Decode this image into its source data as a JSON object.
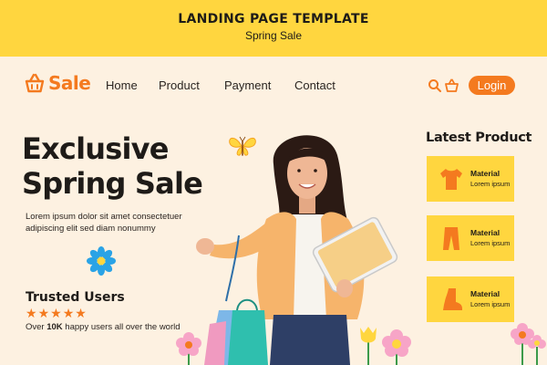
{
  "banner": {
    "title": "LANDING PAGE TEMPLATE",
    "subtitle": "Spring Sale"
  },
  "nav": {
    "brand": "Sale",
    "links": [
      "Home",
      "Product",
      "Payment",
      "Contact"
    ],
    "login_label": "Login",
    "icons": [
      "search-icon",
      "basket-icon"
    ]
  },
  "hero": {
    "headline_line1": "Exclusive",
    "headline_line2": "Spring Sale",
    "description": "Lorem ipsum dolor sit amet consectetuer adipiscing elit sed diam nonummy"
  },
  "trusted": {
    "title": "Trusted Users",
    "rating": 5,
    "desc_prefix": "Over ",
    "desc_count": "10K",
    "desc_suffix": " happy users all over the world"
  },
  "latest": {
    "title": "Latest Product",
    "items": [
      {
        "title": "Material",
        "subtitle": "Lorem ipsum",
        "icon": "tshirt-icon"
      },
      {
        "title": "Material",
        "subtitle": "Lorem ipsum",
        "icon": "pants-icon"
      },
      {
        "title": "Material",
        "subtitle": "Lorem ipsum",
        "icon": "boot-icon"
      }
    ]
  },
  "colors": {
    "accent": "#f47a1f",
    "yellow": "#ffd63f",
    "background": "#fdf1e1"
  }
}
